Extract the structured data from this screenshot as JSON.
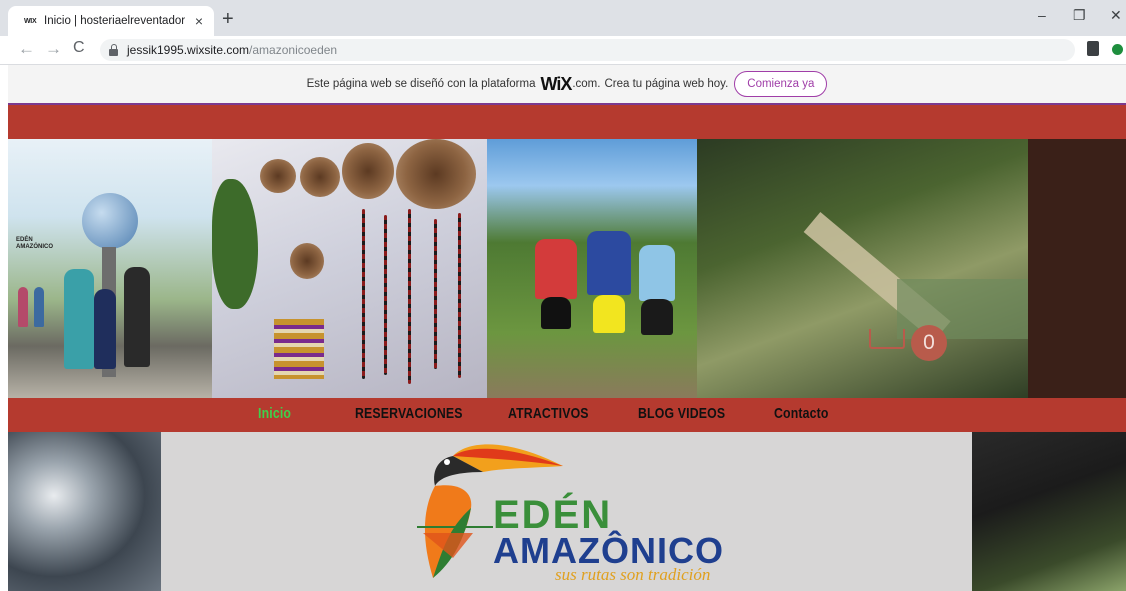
{
  "browser": {
    "tab_favicon": "WIX",
    "tab_title": "Inicio | hosteriaelreventador",
    "tab_close": "×",
    "new_tab": "+",
    "url_host": "jessik1995.wixsite.com",
    "url_path": "/amazonicoeden",
    "minimize": "–",
    "restore": "❐",
    "close": "✕",
    "back": "←",
    "forward": "→",
    "reload": "C"
  },
  "wix_banner": {
    "text_before": "Este página web se diseñó con la plataforma",
    "logo": "WiX",
    "logo_suffix": ".com.",
    "text_after": "Crea tu página web hoy.",
    "cta": "Comienza ya",
    "accent_color": "#a03ea8"
  },
  "header": {
    "logo_line1": "EDÉN",
    "logo_line2": "AMAZÓNICO"
  },
  "cart": {
    "count": "0"
  },
  "menu": {
    "items": [
      {
        "label": "Inicio",
        "active": true
      },
      {
        "label": "RESERVACIONES",
        "active": false
      },
      {
        "label": "ATRACTIVOS",
        "active": false
      },
      {
        "label": "BLOG VIDEOS",
        "active": false
      },
      {
        "label": "Contacto",
        "active": false
      }
    ],
    "bar_color": "#b53a2f",
    "active_color": "#3ed14c"
  },
  "logo": {
    "line1": "EDÉN",
    "line2": "AMAZÔNICO",
    "tagline": "sus rutas son tradición",
    "icon": "toucan-icon"
  }
}
